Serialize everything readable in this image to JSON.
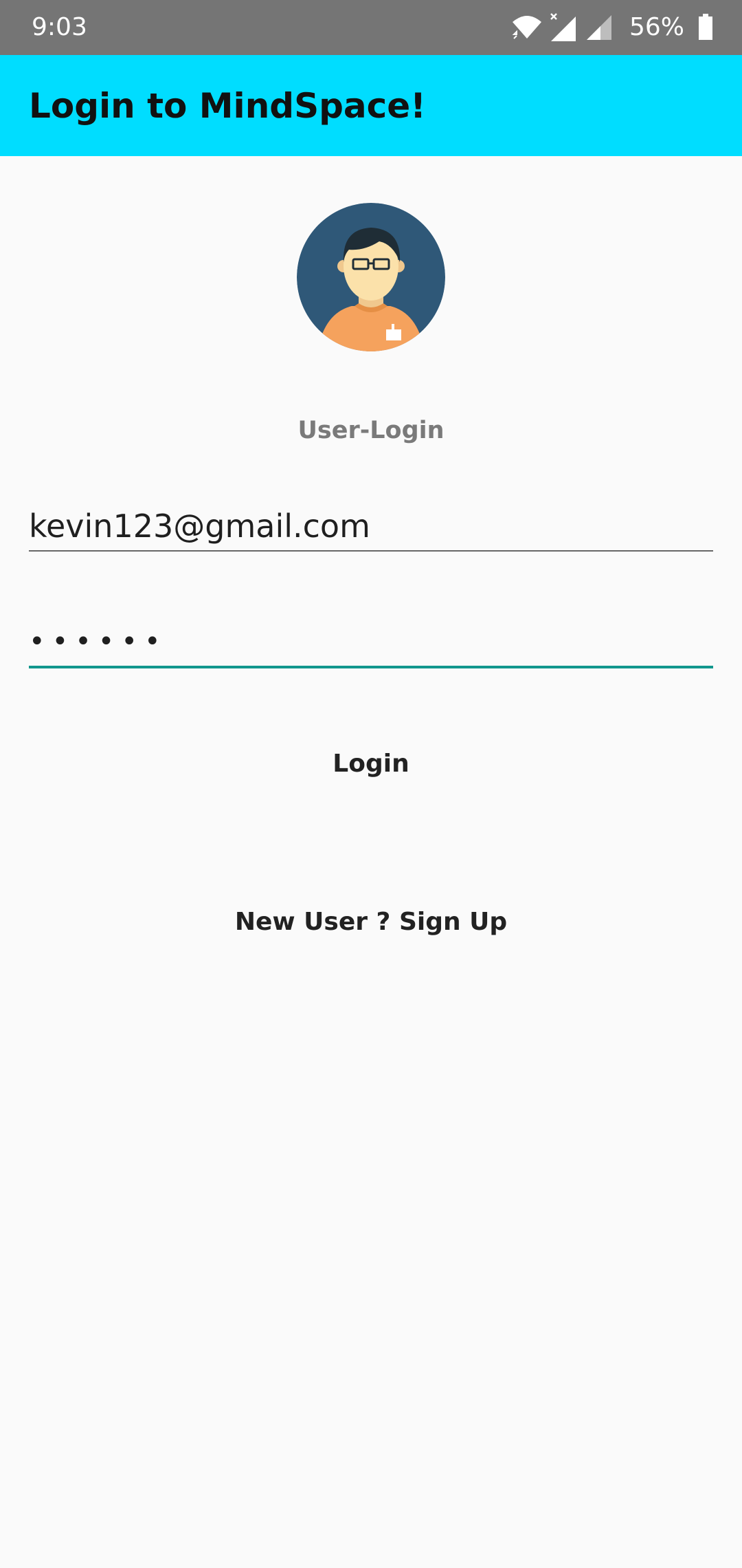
{
  "status_bar": {
    "time": "9:03",
    "battery": "56%",
    "icons": [
      "wifi-icon",
      "signal-x-icon",
      "signal-icon",
      "battery-icon"
    ]
  },
  "app_bar": {
    "title": "Login to MindSpace!",
    "color": "#00ddff"
  },
  "avatar": {
    "icon": "user-avatar-icon"
  },
  "login_form": {
    "heading": "User-Login",
    "email_value": "kevin123@gmail.com",
    "password_masked": "••••••",
    "login_label": "Login",
    "signup_label": "New User ? Sign Up",
    "accent_color": "#12978d"
  }
}
